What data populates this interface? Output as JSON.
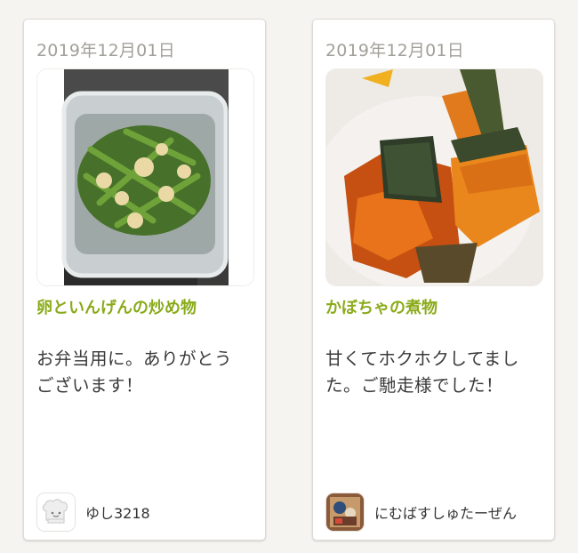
{
  "cards": [
    {
      "date": "2019年12月01日",
      "title": "卵といんげんの炒め物",
      "comment_lines": [
        "お弁当用に。ありがとう",
        "ございます！"
      ],
      "user": "ゆし3218",
      "avatar_icon": "default-chef-icon"
    },
    {
      "date": "2019年12月01日",
      "title": "かぼちゃの煮物",
      "comment_lines": [
        "甘くてホクホクしてまし",
        "た。ご馳走様でした！"
      ],
      "user": "にむばすしゅたーぜん",
      "avatar_icon": "user-photo-avatar"
    }
  ],
  "colors": {
    "title": "#8aab1a",
    "date": "#a3a09a",
    "text": "#3a3a3a",
    "background": "#f5f4f0"
  }
}
